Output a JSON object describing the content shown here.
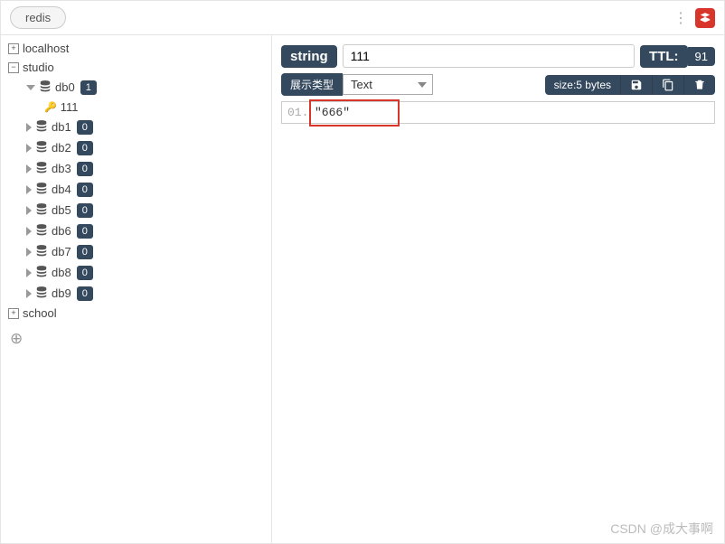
{
  "tab": {
    "label": "redis"
  },
  "tree": {
    "conn_localhost": "localhost",
    "conn_studio": "studio",
    "conn_school": "school",
    "dbs": [
      {
        "name": "db0",
        "count": "1",
        "expanded": true,
        "keys": [
          {
            "name": "111"
          }
        ]
      },
      {
        "name": "db1",
        "count": "0"
      },
      {
        "name": "db2",
        "count": "0"
      },
      {
        "name": "db3",
        "count": "0"
      },
      {
        "name": "db4",
        "count": "0"
      },
      {
        "name": "db5",
        "count": "0"
      },
      {
        "name": "db6",
        "count": "0"
      },
      {
        "name": "db7",
        "count": "0"
      },
      {
        "name": "db8",
        "count": "0"
      },
      {
        "name": "db9",
        "count": "0"
      }
    ]
  },
  "detail": {
    "type_label": "string",
    "key_name": "111",
    "ttl_label": "TTL:",
    "ttl_value": "91",
    "display_type_label": "展示类型",
    "display_type_value": "Text",
    "size_label": "size:5 bytes",
    "line_number": "01.",
    "value": "\"666\""
  },
  "watermark": "CSDN @成大事啊"
}
